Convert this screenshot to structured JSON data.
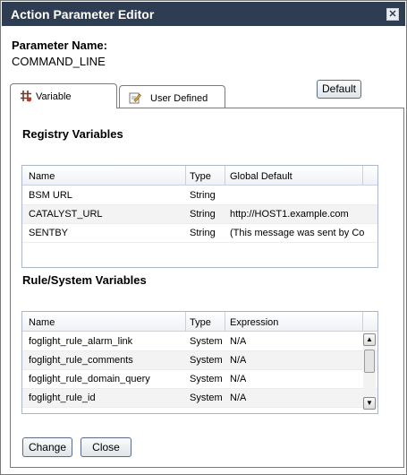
{
  "window": {
    "title": "Action Parameter Editor"
  },
  "parameter": {
    "label": "Parameter Name:",
    "value": "COMMAND_LINE"
  },
  "tabs": [
    {
      "label": "Variable",
      "icon": "registry-variable-icon"
    },
    {
      "label": "User Defined",
      "icon": "pencil-document-icon"
    }
  ],
  "default_button": "Default",
  "registry": {
    "title": "Registry Variables",
    "columns": [
      "Name",
      "Type",
      "Global Default"
    ],
    "rows": [
      [
        "BSM URL",
        "String",
        ""
      ],
      [
        "CATALYST_URL",
        "String",
        "http://HOST1.example.com"
      ],
      [
        "SENTBY",
        "String",
        "(This message was sent by Co"
      ]
    ]
  },
  "rule_system": {
    "title": "Rule/System Variables",
    "columns": [
      "Name",
      "Type",
      "Expression"
    ],
    "rows": [
      [
        "foglight_rule_alarm_link",
        "System",
        "N/A"
      ],
      [
        "foglight_rule_comments",
        "System",
        "N/A"
      ],
      [
        "foglight_rule_domain_query",
        "System",
        "N/A"
      ],
      [
        "foglight_rule_id",
        "System",
        "N/A"
      ]
    ]
  },
  "buttons": {
    "change": "Change",
    "close": "Close"
  },
  "colors": {
    "titlebar": "#2f3d52",
    "grid_border": "#a9b7cc"
  }
}
